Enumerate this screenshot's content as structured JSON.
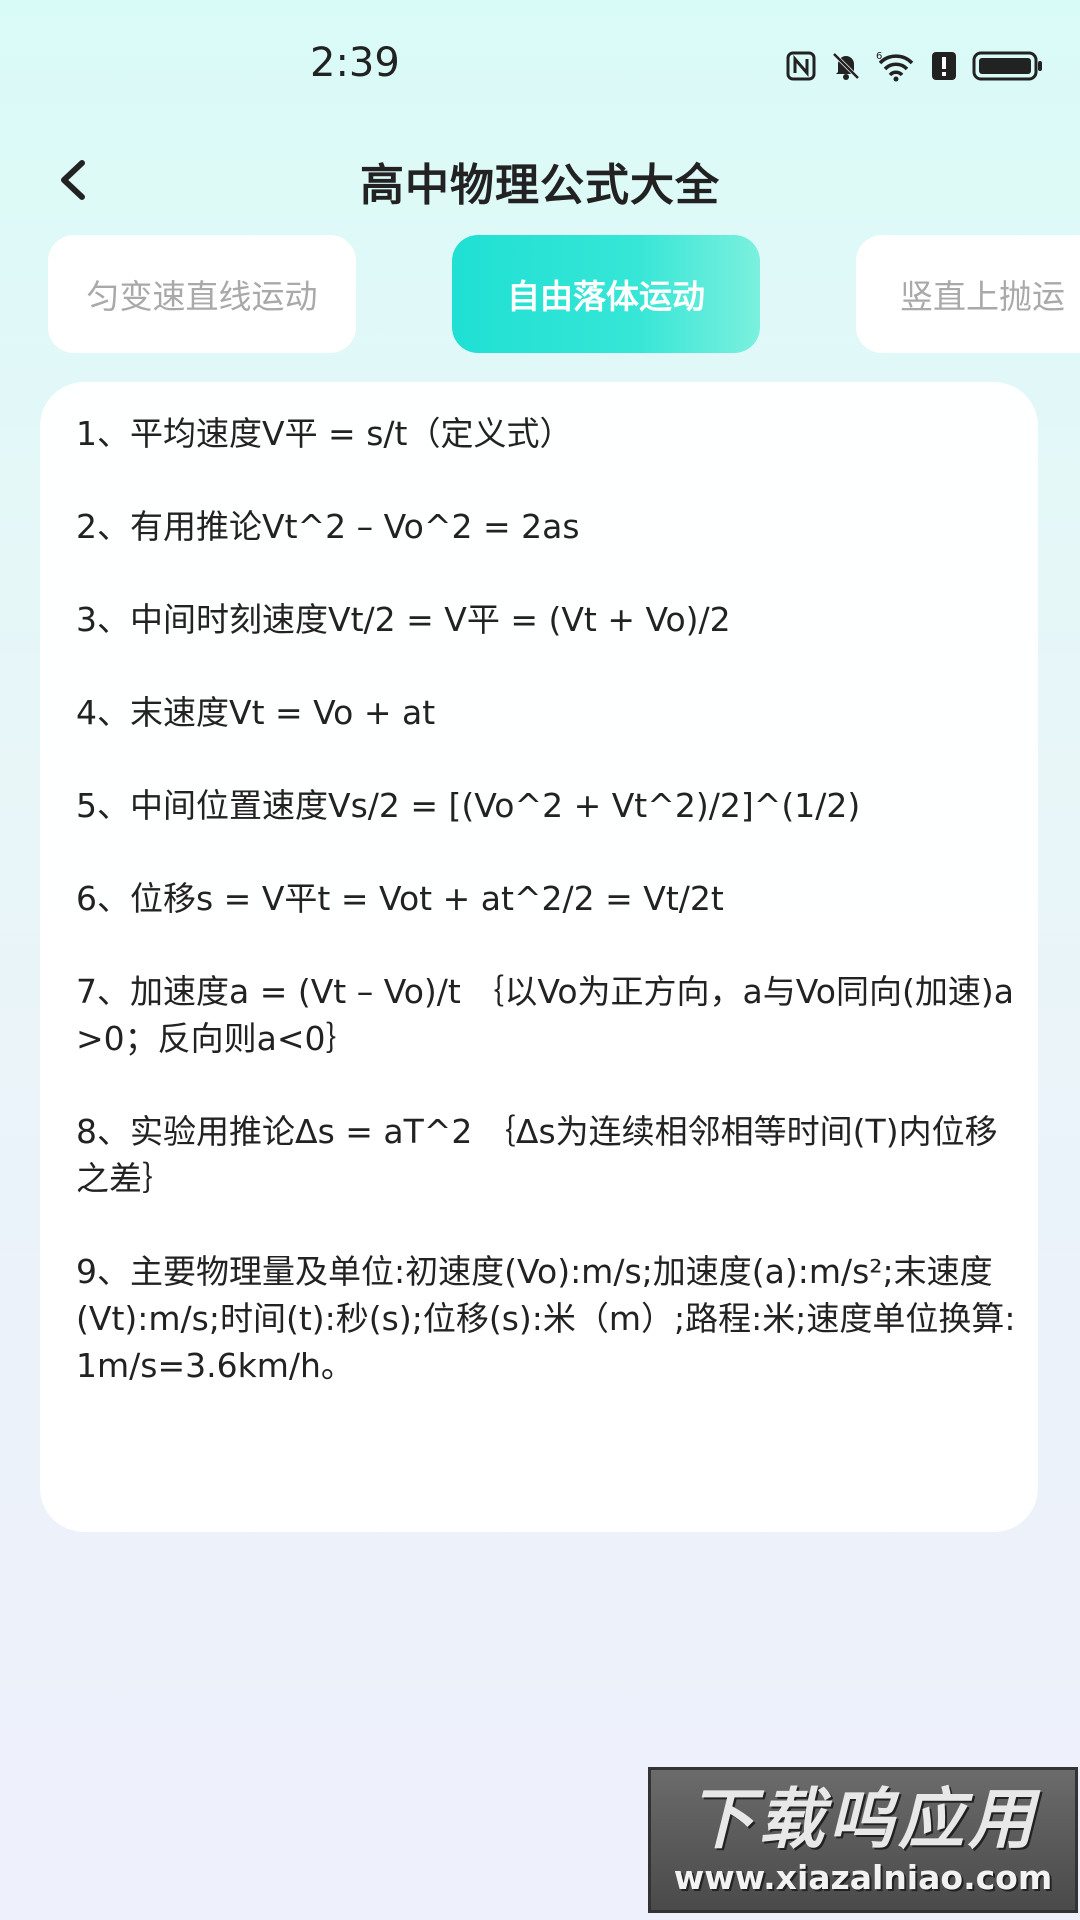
{
  "status_bar": {
    "time": "2:39",
    "icons": [
      "nfc-icon",
      "bell-off-icon",
      "wifi-icon",
      "alert-icon",
      "battery-icon"
    ]
  },
  "header": {
    "title": "高中物理公式大全",
    "back_icon": "chevron-left-icon"
  },
  "tabs": [
    {
      "label": "匀变速直线运动",
      "active": false
    },
    {
      "label": "自由落体运动",
      "active": true
    },
    {
      "label": "竖直上抛运",
      "active": false
    }
  ],
  "formulas": [
    "1、平均速度V平 = s/t（定义式）",
    "2、有用推论Vt^2 – Vo^2 = 2as",
    "3、中间时刻速度Vt/2 = V平 = (Vt + Vo)/2",
    "4、末速度Vt = Vo + at",
    "5、中间位置速度Vs/2 = [(Vo^2 + Vt^2)/2]^(1/2)",
    "6、位移s = V平t = Vot + at^2/2 = Vt/2t",
    "7、加速度a = (Vt – Vo)/t ｛以Vo为正方向，a与Vo同向(加速)a>0；反向则a<0｝",
    "8、实验用推论Δs = aT^2 ｛Δs为连续相邻相等时间(T)内位移之差｝",
    "9、主要物理量及单位:初速度(Vo):m/s;加速度(a):m/s²;末速度(Vt):m/s;时间(t):秒(s);位移(s):米（m）;路程:米;速度单位换算:1m/s=3.6km/h。"
  ],
  "watermark": {
    "main": "下载呜应用",
    "url": "www.xiazalniao.com"
  },
  "colors": {
    "accent_start": "#1fe0d4",
    "accent_end": "#7cf0de",
    "tab_inactive_text": "#a9a9a9"
  }
}
